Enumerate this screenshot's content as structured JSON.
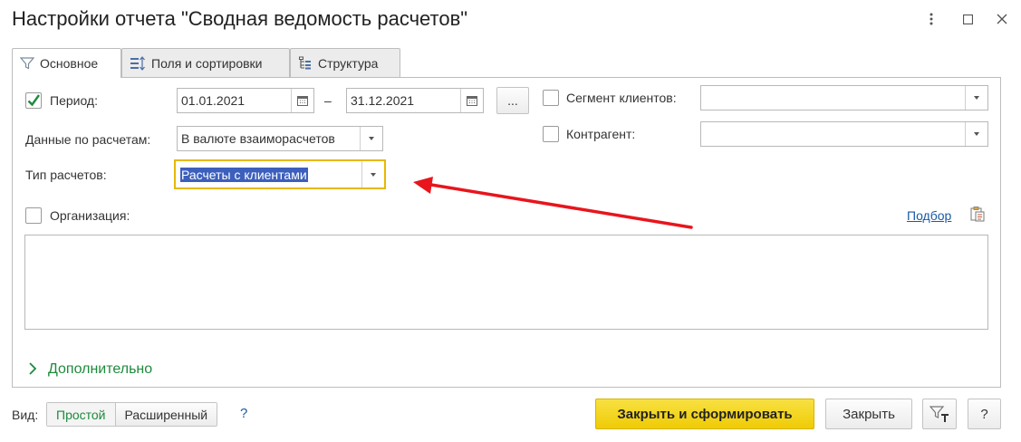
{
  "window": {
    "title": "Настройки отчета \"Сводная ведомость расчетов\"",
    "menu_icon": "more-vertical-icon",
    "maximize_icon": "maximize-icon",
    "close_icon": "close-icon"
  },
  "tabs": [
    {
      "label": "Основное",
      "icon": "filter-icon",
      "active": true
    },
    {
      "label": "Поля и сортировки",
      "icon": "fields-sort-icon",
      "active": false
    },
    {
      "label": "Структура",
      "icon": "structure-icon",
      "active": false
    }
  ],
  "form": {
    "period": {
      "label": "Период:",
      "checked": true,
      "from": "01.01.2021",
      "dash": "–",
      "to": "31.12.2021",
      "more_label": "..."
    },
    "settlement_data": {
      "label": "Данные по расчетам:",
      "value": "В валюте взаиморасчетов"
    },
    "settlement_type": {
      "label": "Тип расчетов:",
      "value": "Расчеты с клиентами"
    },
    "client_segment": {
      "label": "Сегмент клиентов:",
      "checked": false,
      "value": ""
    },
    "counterparty": {
      "label": "Контрагент:",
      "checked": false,
      "value": ""
    },
    "organization": {
      "label": "Организация:",
      "checked": false
    },
    "selection_link": "Подбор",
    "additional_label": "Дополнительно"
  },
  "footer": {
    "view_label": "Вид:",
    "view_simple": "Простой",
    "view_extended": "Расширенный",
    "help_link": "?",
    "primary_button": "Закрыть и сформировать",
    "close_button": "Закрыть",
    "help_button": "?"
  },
  "colors": {
    "primary_button_bg": "#f5d60f",
    "highlight_border": "#e8b800",
    "annotation_arrow": "#e8151c",
    "green_accent": "#1e8a3d",
    "link": "#1a5aa6"
  }
}
